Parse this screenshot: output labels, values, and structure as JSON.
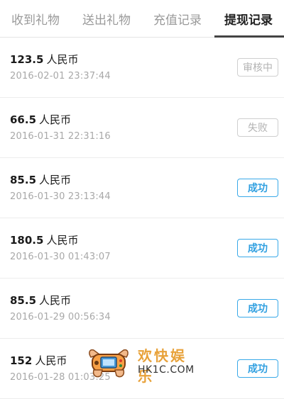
{
  "tabs": [
    {
      "label": "收到礼物",
      "active": false
    },
    {
      "label": "送出礼物",
      "active": false
    },
    {
      "label": "充值记录",
      "active": false
    },
    {
      "label": "提现记录",
      "active": true
    }
  ],
  "records": [
    {
      "amount": "123.5",
      "unit": "人民币",
      "time": "2016-02-01 23:37:44",
      "status": "审核中",
      "status_type": "pending"
    },
    {
      "amount": "66.5",
      "unit": "人民币",
      "time": "2016-01-31 22:31:16",
      "status": "失败",
      "status_type": "failed"
    },
    {
      "amount": "85.5",
      "unit": "人民币",
      "time": "2016-01-30 23:13:44",
      "status": "成功",
      "status_type": "success"
    },
    {
      "amount": "180.5",
      "unit": "人民币",
      "time": "2016-01-30 01:43:07",
      "status": "成功",
      "status_type": "success"
    },
    {
      "amount": "85.5",
      "unit": "人民币",
      "time": "2016-01-29 00:56:34",
      "status": "成功",
      "status_type": "success"
    },
    {
      "amount": "152",
      "unit": "人民币",
      "time": "2016-01-28 01:03:25",
      "status": "成功",
      "status_type": "success"
    }
  ],
  "watermark": {
    "title": "欢快娱乐",
    "subtitle": "HK1C.COM",
    "icon": "game-controller-icon"
  },
  "colors": {
    "success": "#39a9e8",
    "muted": "#b2b2b2",
    "watermark": "#e8a23a"
  }
}
